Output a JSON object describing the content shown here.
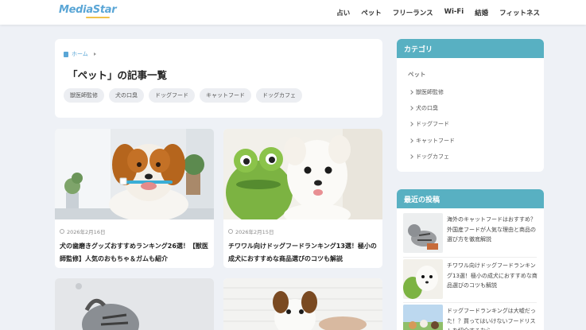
{
  "header": {
    "logo": "MediaStar",
    "nav": [
      "占い",
      "ペット",
      "フリーランス",
      "Wi-Fi",
      "結婚",
      "フィットネス"
    ]
  },
  "main": {
    "breadcrumb": "ホーム",
    "title": "「ペット」の記事一覧",
    "tags": [
      "獣医師監修",
      "犬の口臭",
      "ドッグフード",
      "キャットフード",
      "ドッグカフェ"
    ]
  },
  "articles": [
    {
      "date": "2026年2月16日",
      "title": "犬の歯磨きグッズおすすめランキング26選！【獣医師監修】人気のおもちゃ＆ガムも紹介"
    },
    {
      "date": "2026年2月15日",
      "title": "チワワル向けドッグフードランキング13選！極小の成犬におすすめな商品選びのコツも解説"
    }
  ],
  "sidebar": {
    "category_heading": "カテゴリ",
    "category_root": "ペット",
    "categories": [
      "獣医師監修",
      "犬の口臭",
      "ドッグフード",
      "キャットフード",
      "ドッグカフェ"
    ],
    "recent_heading": "最近の投稿",
    "recent": [
      "海外のキャットフードはおすすめ？外国産フードが人気な理由と商品の選び方を徹底解説",
      "チワワル向けドッグフードランキング13選！極小の成犬におすすめな商品選びのコツも解説",
      "ドッグフードランキングは大嘘だった！？買ってはいけないフードリストを紹介するなら"
    ]
  },
  "colors": {
    "accent": "#58b0c2",
    "logo": "#5aa6d6",
    "background": "#eef1f6"
  }
}
